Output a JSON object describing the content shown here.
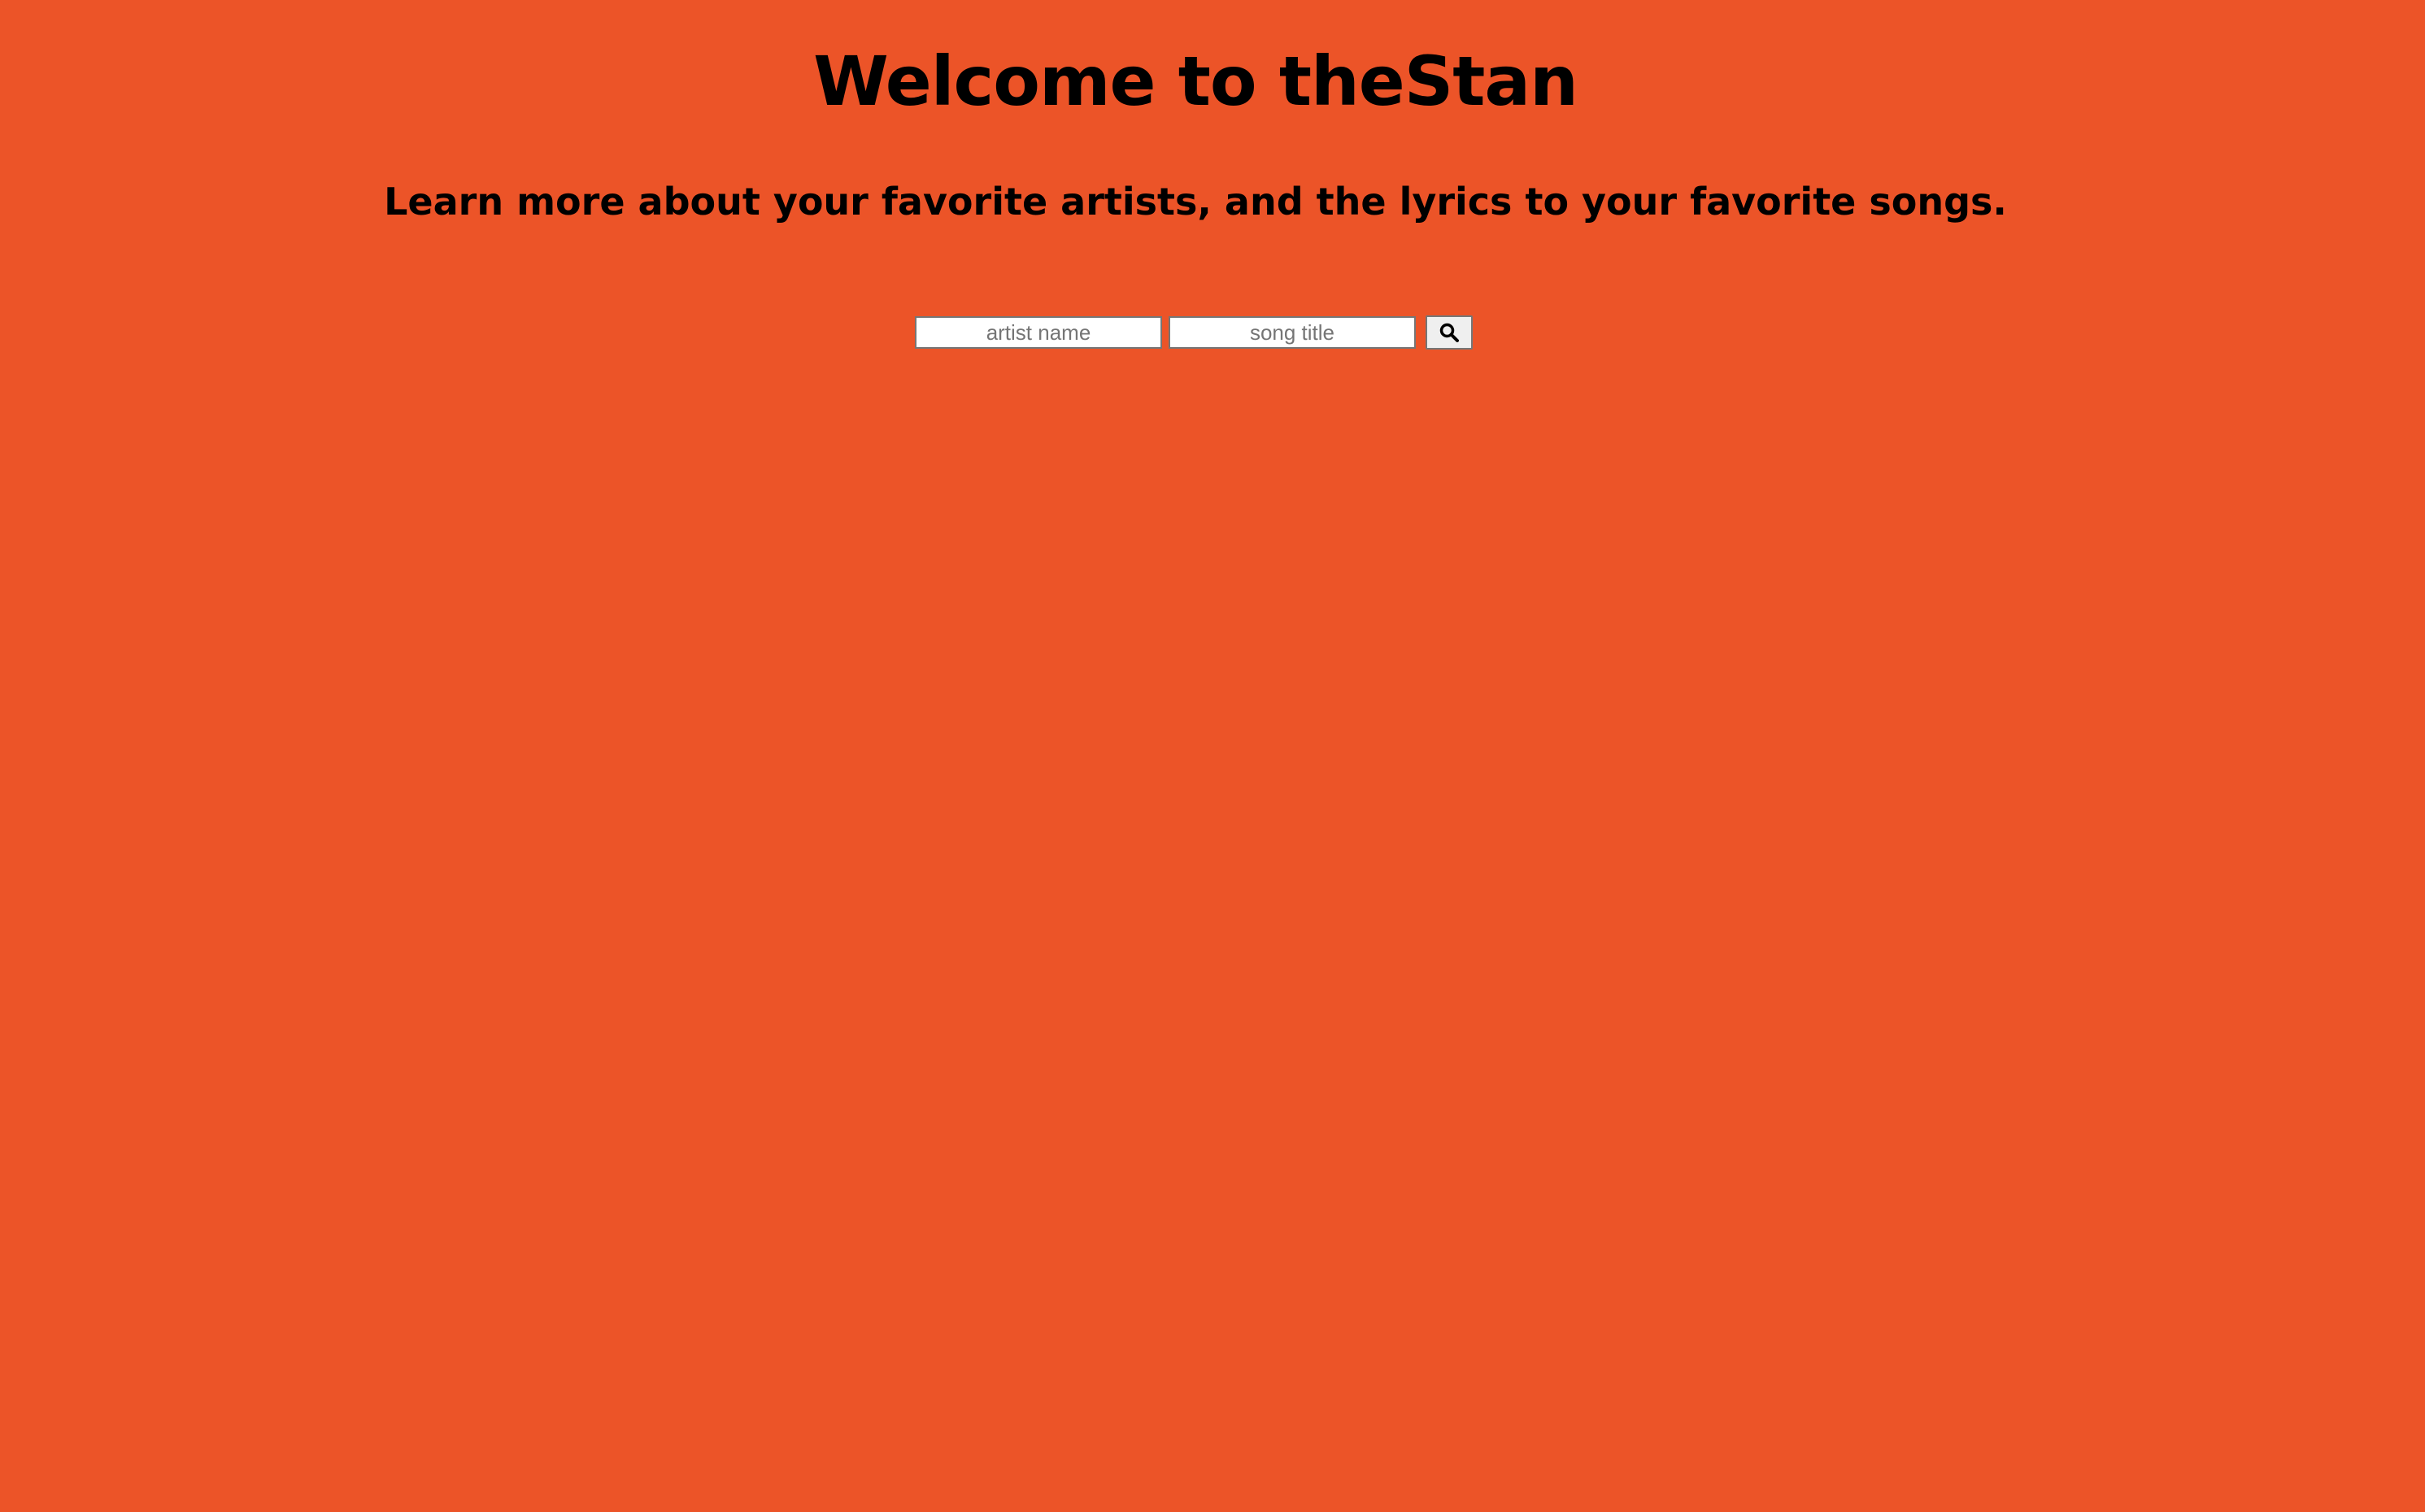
{
  "header": {
    "title": "Welcome to theStan",
    "subtitle": "Learn more about your favorite artists, and the lyrics to your favorite songs."
  },
  "search": {
    "artist_placeholder": "artist name",
    "song_placeholder": "song title",
    "artist_value": "",
    "song_value": "",
    "button_icon": "search-icon"
  },
  "colors": {
    "background": "#EC5428",
    "text": "#000000"
  }
}
